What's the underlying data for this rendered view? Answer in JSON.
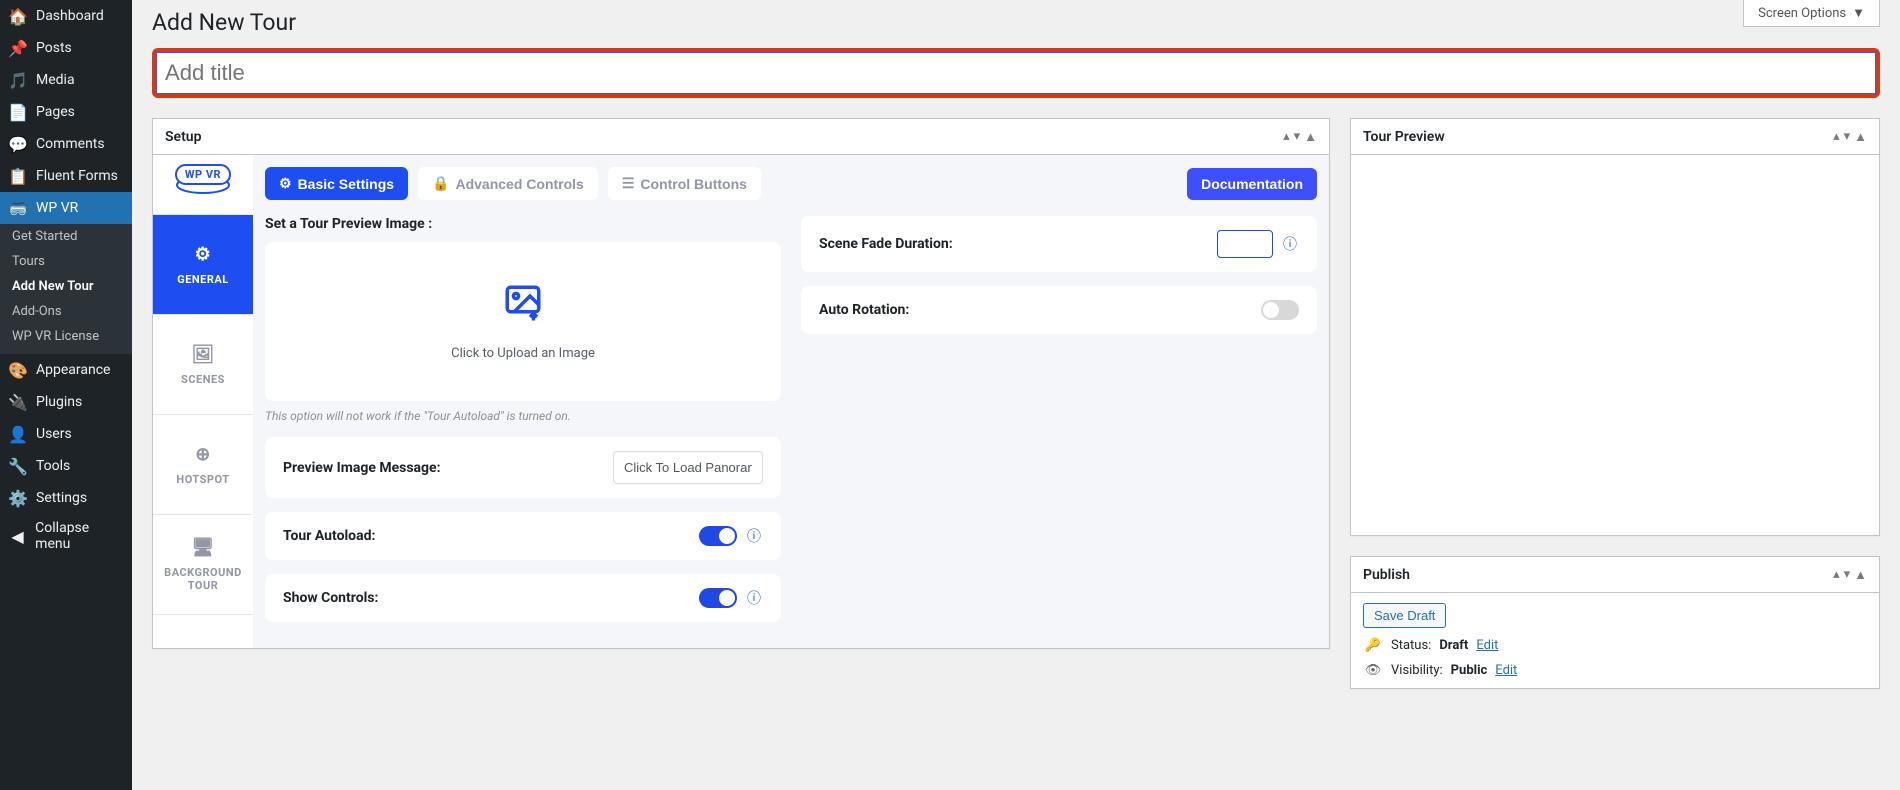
{
  "screen_options": "Screen Options",
  "page_title": "Add New Tour",
  "title_placeholder": "Add title",
  "sidebar": {
    "items": [
      {
        "label": "Dashboard"
      },
      {
        "label": "Posts"
      },
      {
        "label": "Media"
      },
      {
        "label": "Pages"
      },
      {
        "label": "Comments"
      },
      {
        "label": "Fluent Forms"
      },
      {
        "label": "WP VR"
      },
      {
        "label": "Appearance"
      },
      {
        "label": "Plugins"
      },
      {
        "label": "Users"
      },
      {
        "label": "Tools"
      },
      {
        "label": "Settings"
      },
      {
        "label": "Collapse menu"
      }
    ],
    "subitems": [
      {
        "label": "Get Started"
      },
      {
        "label": "Tours"
      },
      {
        "label": "Add New Tour"
      },
      {
        "label": "Add-Ons"
      },
      {
        "label": "WP VR License"
      }
    ]
  },
  "setup": {
    "title": "Setup",
    "logo": "WP VR",
    "tabs": {
      "basic": "Basic Settings",
      "advanced": "Advanced Controls",
      "control": "Control Buttons"
    },
    "doc": "Documentation",
    "nav": {
      "general": "GENERAL",
      "scenes": "SCENES",
      "hotspot": "HOTSPOT",
      "background": "BACKGROUND TOUR"
    },
    "preview_image_label": "Set a Tour Preview Image :",
    "upload_text": "Click to Upload an Image",
    "preview_hint": "This option will not work if the \"Tour Autoload\" is turned on.",
    "preview_message_label": "Preview Image Message:",
    "preview_message_value": "Click To Load Panoram",
    "tour_autoload_label": "Tour Autoload:",
    "show_controls_label": "Show Controls:",
    "fade_duration_label": "Scene Fade Duration:",
    "auto_rotation_label": "Auto Rotation:"
  },
  "tour_preview_title": "Tour Preview",
  "publish": {
    "title": "Publish",
    "save_draft": "Save Draft",
    "status_label": "Status:",
    "status_value": "Draft",
    "visibility_label": "Visibility:",
    "visibility_value": "Public",
    "edit": "Edit"
  }
}
